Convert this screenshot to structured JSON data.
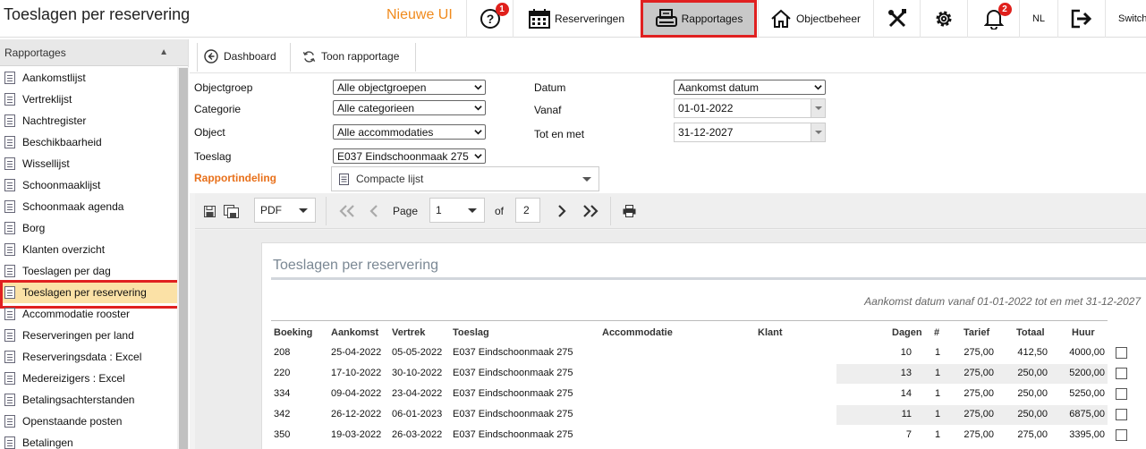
{
  "header": {
    "page_title": "Toeslagen per reservering",
    "brand": "Nieuwe UI",
    "help_badge": "1",
    "nav": {
      "reserveringen": "Reserveringen",
      "rapportages": "Rapportages",
      "objectbeheer": "Objectbeheer"
    },
    "notifications_badge": "2",
    "language": "NL",
    "switch_label": "Switch"
  },
  "sidebar": {
    "title": "Rapportages",
    "items": [
      {
        "label": "Aankomstlijst"
      },
      {
        "label": "Vertreklijst"
      },
      {
        "label": "Nachtregister"
      },
      {
        "label": "Beschikbaarheid"
      },
      {
        "label": "Wissellijst"
      },
      {
        "label": "Schoonmaaklijst"
      },
      {
        "label": "Schoonmaak agenda"
      },
      {
        "label": "Borg"
      },
      {
        "label": "Klanten overzicht"
      },
      {
        "label": "Toeslagen per dag"
      },
      {
        "label": "Toeslagen per reservering"
      },
      {
        "label": "Accommodatie rooster"
      },
      {
        "label": "Reserveringen per land"
      },
      {
        "label": "Reserveringsdata : Excel"
      },
      {
        "label": "Medereizigers : Excel"
      },
      {
        "label": "Betalingsachterstanden"
      },
      {
        "label": "Openstaande posten"
      },
      {
        "label": "Betalingen"
      }
    ],
    "active_index": 10
  },
  "toolbar": {
    "dashboard": "Dashboard",
    "toon_rapportage": "Toon rapportage"
  },
  "filters": {
    "objectgroep": {
      "label": "Objectgroep",
      "value": "Alle objectgroepen"
    },
    "categorie": {
      "label": "Categorie",
      "value": "Alle categorieen"
    },
    "object": {
      "label": "Object",
      "value": "Alle accommodaties"
    },
    "toeslag": {
      "label": "Toeslag",
      "value": "E037 Eindschoonmaak 275"
    },
    "datum": {
      "label": "Datum",
      "value": "Aankomst datum"
    },
    "vanaf": {
      "label": "Vanaf",
      "value": "01-01-2022"
    },
    "tot_en_met": {
      "label": "Tot en met",
      "value": "31-12-2027"
    },
    "rapportindeling": {
      "label": "Rapportindeling",
      "value": "Compacte lijst"
    }
  },
  "viewer": {
    "format": "PDF",
    "page_label": "Page",
    "page_current": "1",
    "of_label": "of",
    "page_total": "2"
  },
  "report": {
    "title": "Toeslagen per reservering",
    "subtitle": "Aankomst datum vanaf 01-01-2022 tot en met 31-12-2027",
    "columns": {
      "boeking": "Boeking",
      "aankomst": "Aankomst",
      "vertrek": "Vertrek",
      "toeslag": "Toeslag",
      "accommodatie": "Accommodatie",
      "klant": "Klant",
      "dagen": "Dagen",
      "aantal": "#",
      "tarief": "Tarief",
      "totaal": "Totaal",
      "huur": "Huur"
    },
    "rows": [
      {
        "boeking": "208",
        "aankomst": "25-04-2022",
        "vertrek": "05-05-2022",
        "toeslag": "E037 Eindschoonmaak 275",
        "accommodatie": "",
        "klant": "",
        "dagen": "10",
        "aantal": "1",
        "tarief": "275,00",
        "totaal": "412,50",
        "huur": "4000,00"
      },
      {
        "boeking": "220",
        "aankomst": "17-10-2022",
        "vertrek": "30-10-2022",
        "toeslag": "E037 Eindschoonmaak 275",
        "accommodatie": "",
        "klant": "",
        "dagen": "13",
        "aantal": "1",
        "tarief": "275,00",
        "totaal": "250,00",
        "huur": "5200,00"
      },
      {
        "boeking": "334",
        "aankomst": "09-04-2022",
        "vertrek": "23-04-2022",
        "toeslag": "E037 Eindschoonmaak 275",
        "accommodatie": "",
        "klant": "",
        "dagen": "14",
        "aantal": "1",
        "tarief": "275,00",
        "totaal": "250,00",
        "huur": "5250,00"
      },
      {
        "boeking": "342",
        "aankomst": "26-12-2022",
        "vertrek": "06-01-2023",
        "toeslag": "E037 Eindschoonmaak 275",
        "accommodatie": "",
        "klant": "",
        "dagen": "11",
        "aantal": "1",
        "tarief": "275,00",
        "totaal": "250,00",
        "huur": "6875,00"
      },
      {
        "boeking": "350",
        "aankomst": "19-03-2022",
        "vertrek": "26-03-2022",
        "toeslag": "E037 Eindschoonmaak 275",
        "accommodatie": "",
        "klant": "",
        "dagen": "7",
        "aantal": "1",
        "tarief": "275,00",
        "totaal": "275,00",
        "huur": "3395,00"
      }
    ]
  },
  "colors": {
    "brand": "#f08a1c",
    "accent_orange": "#e8701a",
    "highlight_red": "#e02020",
    "active_item": "#fbe1a6",
    "badge_red": "#e0201c"
  }
}
